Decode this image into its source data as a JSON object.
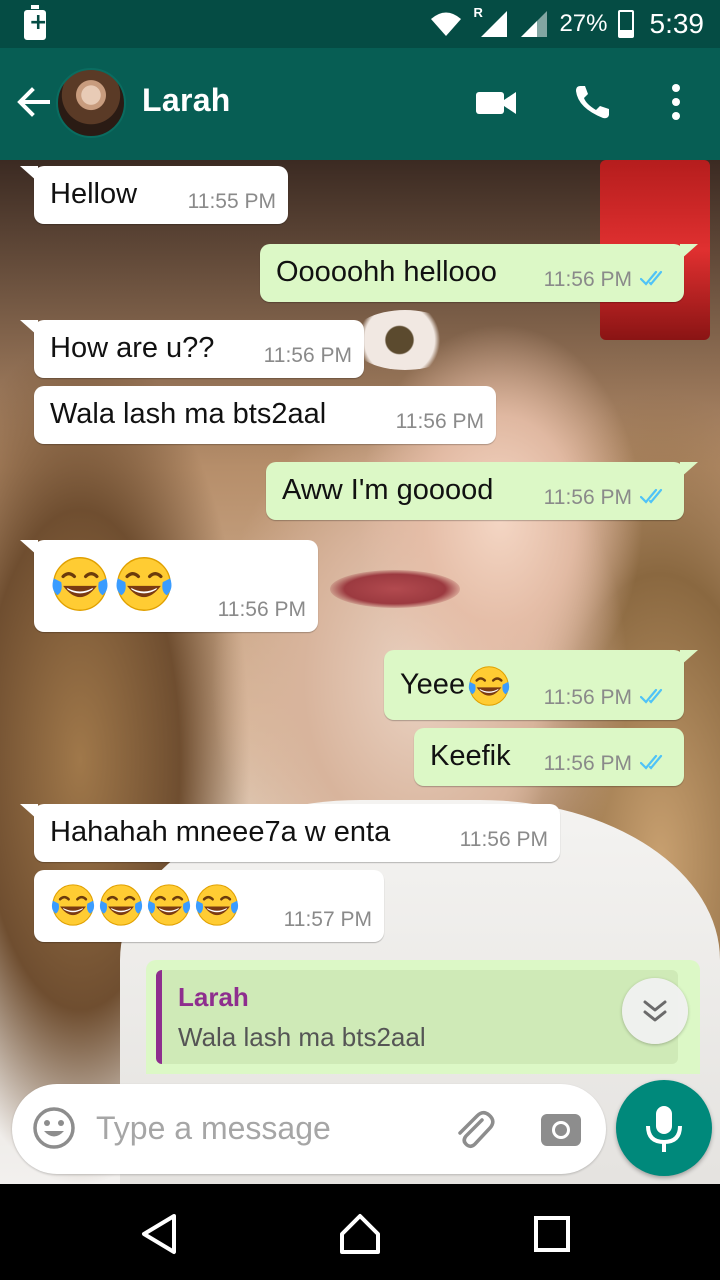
{
  "status_bar": {
    "battery_percent": "27%",
    "time": "5:39",
    "roaming_indicator": "R",
    "icons": [
      "battery-saver-icon",
      "wifi-icon",
      "signal-roaming-icon",
      "signal-icon",
      "battery-icon"
    ]
  },
  "header": {
    "contact_name": "Larah",
    "icons": [
      "back-arrow-icon",
      "avatar",
      "video-call-icon",
      "voice-call-icon",
      "more-options-icon"
    ]
  },
  "messages": [
    {
      "direction": "in",
      "text": "Hellow",
      "time": "11:55 PM"
    },
    {
      "direction": "out",
      "text": "Ooooohh hellooo",
      "time": "11:56 PM",
      "status": "read"
    },
    {
      "direction": "in",
      "text": "How are u??",
      "time": "11:56 PM"
    },
    {
      "direction": "in",
      "text": "Wala lash ma bts2aal",
      "time": "11:56 PM"
    },
    {
      "direction": "out",
      "text": "Aww I'm gooood",
      "time": "11:56 PM",
      "status": "read"
    },
    {
      "direction": "in",
      "text": "",
      "emoji_count": 2,
      "emoji": "tears-of-joy",
      "time": "11:56 PM"
    },
    {
      "direction": "out",
      "text": "Yeee",
      "emoji_count": 1,
      "emoji": "tears-of-joy",
      "time": "11:56 PM",
      "status": "read"
    },
    {
      "direction": "out",
      "text": "Keefik",
      "time": "11:56 PM",
      "status": "read"
    },
    {
      "direction": "in",
      "text": "Hahahah mneee7a w enta",
      "time": "11:56 PM"
    },
    {
      "direction": "in",
      "text": "",
      "emoji_count": 4,
      "emoji": "tears-of-joy",
      "time": "11:57 PM"
    }
  ],
  "reply_preview": {
    "author": "Larah",
    "text": "Wala lash ma bts2aal"
  },
  "composer": {
    "placeholder": "Type a message",
    "value": ""
  },
  "colors": {
    "header": "#075e54",
    "status_bar": "#054c44",
    "outgoing_bubble": "#dcf8c6",
    "incoming_bubble": "#ffffff",
    "read_ticks": "#4fc3f7",
    "mic_button": "#00897b",
    "reply_accent": "#8e2e8e"
  }
}
